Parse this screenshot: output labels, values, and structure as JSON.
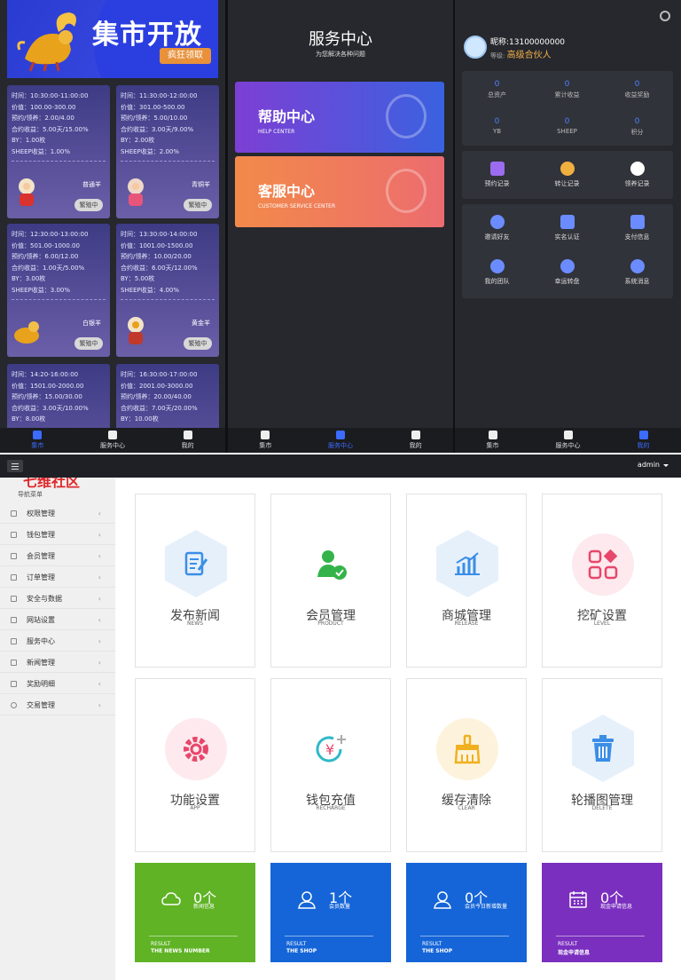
{
  "market": {
    "banner_title": "集市开放",
    "banner_button": "疯狂领取",
    "cards": [
      {
        "time": "时间：10:30:00-11:00:00",
        "price": "价值：100.00-300.00",
        "reserve": "预约/领养：2.00/4.00",
        "contract": "合约收益：5.00天/15.00%",
        "by": "BY：1.00枚",
        "sheep": "SHEEP收益：1.00%",
        "name": "普通羊",
        "status": "繁殖中"
      },
      {
        "time": "时间：11:30:00-12:00:00",
        "price": "价值：301.00-500.00",
        "reserve": "预约/领养：5.00/10.00",
        "contract": "合约收益：3.00天/9.00%",
        "by": "BY：2.00枚",
        "sheep": "SHEEP收益：2.00%",
        "name": "青铜羊",
        "status": "繁殖中"
      },
      {
        "time": "时间：12:30:00-13:00:00",
        "price": "价值：501.00-1000.00",
        "reserve": "预约/领养：6.00/12.00",
        "contract": "合约收益：1.00天/5.00%",
        "by": "BY：3.00枚",
        "sheep": "SHEEP收益：3.00%",
        "name": "白银羊",
        "status": "繁殖中"
      },
      {
        "time": "时间：13:30:00-14:00:00",
        "price": "价值：1001.00-1500.00",
        "reserve": "预约/领养：10.00/20.00",
        "contract": "合约收益：6.00天/12.00%",
        "by": "BY：5.00枚",
        "sheep": "SHEEP收益：4.00%",
        "name": "黄金羊",
        "status": "繁殖中"
      },
      {
        "time": "时间：14:20-16:00:00",
        "price": "价值：1501.00-2000.00",
        "reserve": "预约/领养：15.00/30.00",
        "contract": "合约收益：3.00天/10.00%",
        "by": "BY：8.00枚"
      },
      {
        "time": "时间：16:30:00-17:00:00",
        "price": "价值：2001.00-3000.00",
        "reserve": "预约/领养：20.00/40.00",
        "contract": "合约收益：7.00天/20.00%",
        "by": "BY：10.00枚"
      }
    ]
  },
  "tabbar": {
    "market": "集市",
    "service": "服务中心",
    "mine": "我的"
  },
  "service": {
    "title": "服务中心",
    "subtitle": "为您解决各种问题",
    "help_zh": "帮助中心",
    "help_en": "HELP CENTER",
    "cust_zh": "客服中心",
    "cust_en": "CUSTOMER SERVICE CENTER"
  },
  "profile": {
    "nickname": "昵称:13100000000",
    "level_label": "等级:",
    "level": "高级合伙人",
    "stats": [
      {
        "value": "0",
        "label": "总资产"
      },
      {
        "value": "0",
        "label": "累计收益"
      },
      {
        "value": "0",
        "label": "收益奖励"
      },
      {
        "value": "0",
        "label": "YB"
      },
      {
        "value": "0",
        "label": "SHEEP"
      },
      {
        "value": "0",
        "label": "积分"
      }
    ],
    "records": [
      "预约记录",
      "转让记录",
      "领养记录"
    ],
    "actions": [
      "邀请好友",
      "实名认证",
      "支付信息",
      "我的团队",
      "幸运转盘",
      "系统消息"
    ]
  },
  "admin": {
    "user": "admin",
    "logo": "七维社区",
    "nav_title": "导航菜单",
    "menu": [
      "权限管理",
      "钱包管理",
      "会员管理",
      "订单管理",
      "安全与数据",
      "网站设置",
      "服务中心",
      "新闻管理",
      "奖励明细",
      "交易管理"
    ],
    "tiles": [
      {
        "zh": "发布新闻",
        "en": "NEWS"
      },
      {
        "zh": "会员管理",
        "en": "PRODUCT"
      },
      {
        "zh": "商城管理",
        "en": "RELEASE"
      },
      {
        "zh": "挖矿设置",
        "en": "LEVEL"
      },
      {
        "zh": "功能设置",
        "en": "APP"
      },
      {
        "zh": "钱包充值",
        "en": "RECHARGE"
      },
      {
        "zh": "缓存清除",
        "en": "CLEAR"
      },
      {
        "zh": "轮播图管理",
        "en": "DELETE"
      }
    ],
    "counters": [
      {
        "count": "0个",
        "label": "新闻信息",
        "r1": "RESULT",
        "r2": "THE NEWS NUMBER",
        "color": "#5fb325"
      },
      {
        "count": "1个",
        "label": "会员数量",
        "r1": "RESULT",
        "r2": "THE SHOP",
        "color": "#1565d8"
      },
      {
        "count": "0个",
        "label": "会员今日新增数量",
        "r1": "RESULT",
        "r2": "THE SHOP",
        "color": "#1565d8"
      },
      {
        "count": "0个",
        "label": "现金申请信息",
        "r1": "RESULT",
        "r2": "现金申请信息",
        "color": "#7a2fbf"
      }
    ]
  }
}
